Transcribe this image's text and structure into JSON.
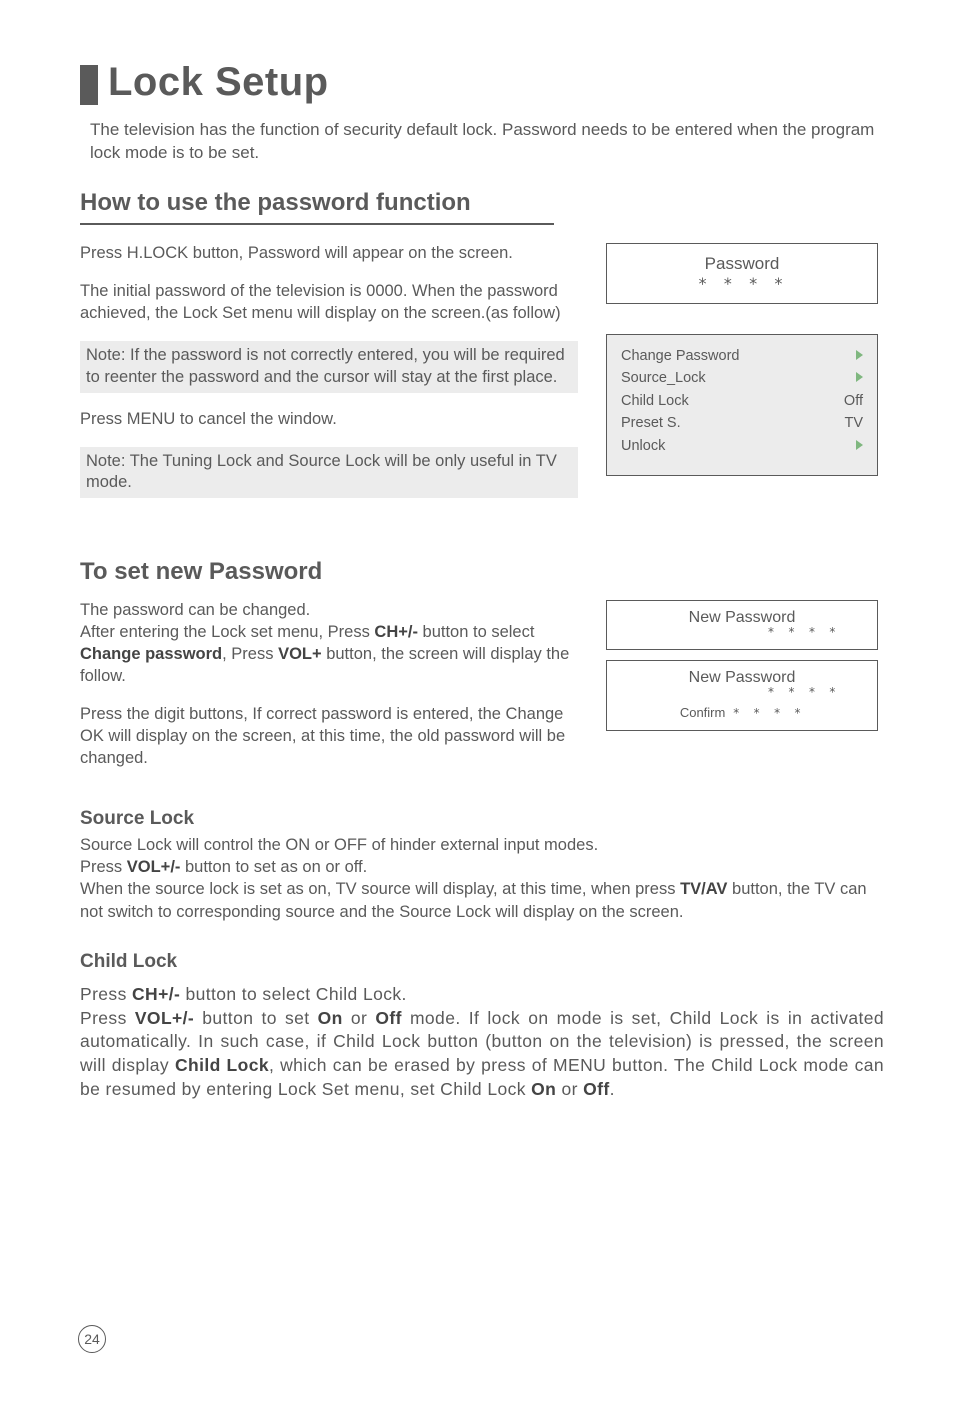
{
  "title": "Lock Setup",
  "intro": "The television has the function of security default lock. Password needs to be entered when the program lock mode is to be set.",
  "how": {
    "heading": "How to use the password function",
    "p1": "Press H.LOCK button, Password will appear on the screen.",
    "p2": " The initial password of the television is 0000. When the password achieved, the Lock Set menu will display on the screen.(as follow)",
    "note1": "Note: If the password is not correctly entered, you will be required to reenter the password and the cursor will stay at the first place.",
    "p3": "Press MENU to cancel the window.",
    "note2": "Note: The Tuning Lock and Source Lock will be only useful in TV mode."
  },
  "password_panel": {
    "title": "Password",
    "stars": "* * * *"
  },
  "menu_panel": {
    "items": [
      {
        "label": "Change Password",
        "value": "",
        "chev": true
      },
      {
        "label": "Source_Lock",
        "value": "",
        "chev": true
      },
      {
        "label": "Child Lock",
        "value": "Off",
        "chev": false
      },
      {
        "label": "Preset S.",
        "value": "TV",
        "chev": false
      },
      {
        "label": "Unlock",
        "value": "",
        "chev": true
      }
    ]
  },
  "set_pw": {
    "heading": "To set new Password",
    "p1a": "The password can be changed.",
    "p1b": "After entering the Lock set menu, Press ",
    "p1b_bold1": "CH+/-",
    "p1c": " button to select ",
    "p1c_bold2": "Change password",
    "p1d": ", Press ",
    "p1d_bold3": "VOL+",
    "p1e": " button, the screen will display the follow.",
    "p2": "Press the digit buttons, If correct password is entered, the Change OK will display on the screen, at this time, the old password will be changed."
  },
  "new_pw_panel1": {
    "title": "New Password",
    "stars": "* * * *"
  },
  "new_pw_panel2": {
    "title": "New Password",
    "stars": "* * * *",
    "confirm_label": "Confirm",
    "confirm_stars": "* * * *"
  },
  "source_lock": {
    "heading": "Source Lock",
    "l1": "Source Lock will control the ON or OFF of hinder external input modes.",
    "l2a": "Press ",
    "l2b": "VOL+/-",
    "l2c": " button to set as on or off.",
    "l3a": "When the source lock is set as on, TV source will display, at this time, when press ",
    "l3b": "TV/AV",
    "l3c": " button, the TV can not switch to corresponding source and the Source Lock will display on the screen."
  },
  "child_lock": {
    "heading": "Child Lock",
    "l1a": "Press ",
    "l1b": "CH+/-",
    "l1c": " button to select Child Lock.",
    "l2a": "Press ",
    "l2b": "VOL+/-",
    "l2c": " button to set ",
    "l2d": "On",
    "l2e": " or ",
    "l2f": "Off",
    "l2g": " mode. If lock on mode is set, Child Lock is in activated automatically. In such case, if Child Lock button (button on the television) is pressed, the screen will display ",
    "l2h": "Child Lock",
    "l2i": ", which can be erased by press of MENU button. The Child Lock mode can be resumed by entering Lock Set menu, set Child Lock ",
    "l2j": "On",
    "l2k": " or ",
    "l2l": "Off",
    "l2m": "."
  },
  "page_number": "24"
}
